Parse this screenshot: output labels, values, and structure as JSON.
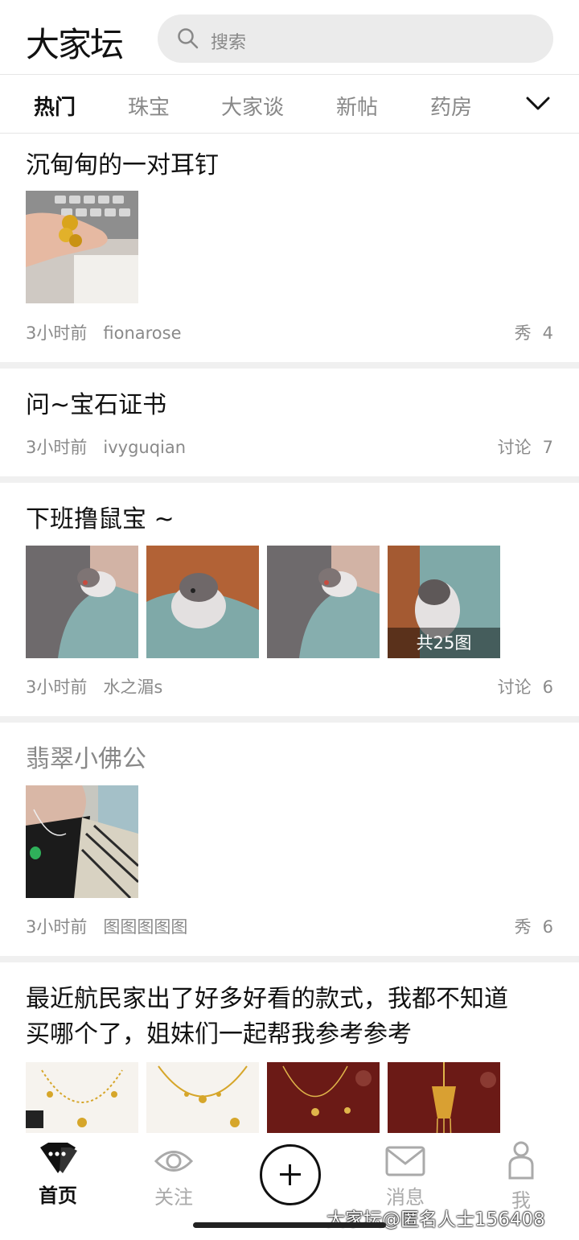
{
  "app": {
    "logo": "大家坛"
  },
  "search": {
    "placeholder": "搜索"
  },
  "tabs": [
    {
      "label": "热门",
      "active": true
    },
    {
      "label": "珠宝",
      "active": false
    },
    {
      "label": "大家谈",
      "active": false
    },
    {
      "label": "新帖",
      "active": false
    },
    {
      "label": "药房",
      "active": false
    }
  ],
  "posts": [
    {
      "title": "沉甸甸的一对耳钉",
      "time": "3小时前",
      "author": "fionarose",
      "category": "秀",
      "count": "4"
    },
    {
      "title": "问~宝石证书",
      "time": "3小时前",
      "author": "ivyguqian",
      "category": "讨论",
      "count": "7"
    },
    {
      "title": "下班撸鼠宝 ~",
      "time": "3小时前",
      "author": "水之湄s",
      "category": "讨论",
      "count": "6",
      "image_count_label": "共25图"
    },
    {
      "title": "翡翠小佛公",
      "time": "3小时前",
      "author": "图图图图图",
      "category": "秀",
      "count": "6"
    },
    {
      "title_line1": "最近航民家出了好多好看的款式，我都不知道",
      "title_line2": "买哪个了，姐妹们一起帮我参考参考"
    }
  ],
  "tabbar": [
    {
      "label": "首页",
      "icon": "home-gem-icon",
      "active": true
    },
    {
      "label": "关注",
      "icon": "eye-icon",
      "active": false
    },
    {
      "label": "",
      "icon": "plus-icon",
      "active": false
    },
    {
      "label": "消息",
      "icon": "mail-icon",
      "active": false
    },
    {
      "label": "我",
      "icon": "person-icon",
      "active": false
    }
  ],
  "watermark": "大家坛@匿名人士156408",
  "colors": {
    "accent": "#111111",
    "muted": "#8a8a8a",
    "divider": "#f0f0f0",
    "search_bg": "#ebebeb"
  }
}
